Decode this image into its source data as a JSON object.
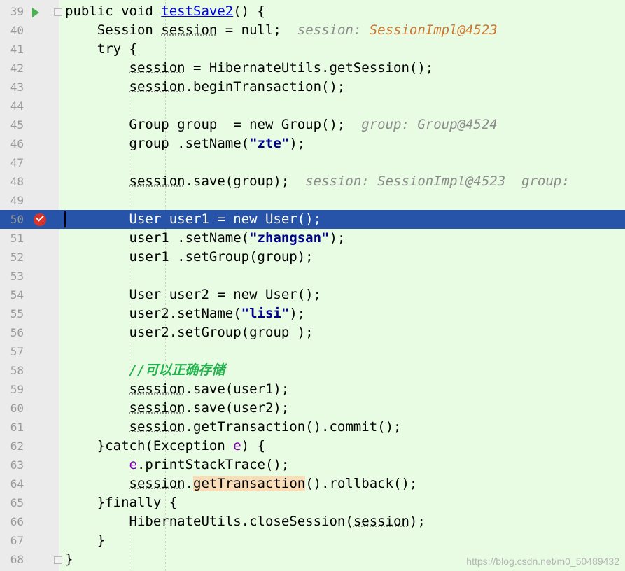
{
  "editor": {
    "lines": [
      {
        "num": "39",
        "segments": [
          {
            "t": "public void "
          },
          {
            "t": "testSave2",
            "c": "method-def"
          },
          {
            "t": "() {"
          }
        ]
      },
      {
        "num": "40",
        "segments": [
          {
            "t": "    Session "
          },
          {
            "t": "session",
            "c": "ul"
          },
          {
            "t": " = null;  "
          },
          {
            "t": "session: ",
            "c": "hint"
          },
          {
            "t": "SessionImpl@4523",
            "c": "hint-val"
          }
        ]
      },
      {
        "num": "41",
        "segments": [
          {
            "t": "    try {"
          }
        ]
      },
      {
        "num": "42",
        "segments": [
          {
            "t": "        "
          },
          {
            "t": "session",
            "c": "ul"
          },
          {
            "t": " = HibernateUtils.getSession();"
          }
        ]
      },
      {
        "num": "43",
        "segments": [
          {
            "t": "        "
          },
          {
            "t": "session",
            "c": "ul"
          },
          {
            "t": ".beginTransaction();"
          }
        ]
      },
      {
        "num": "44",
        "segments": [
          {
            "t": ""
          }
        ]
      },
      {
        "num": "45",
        "segments": [
          {
            "t": "        Group group  = new Group();  "
          },
          {
            "t": "group: Group@4524",
            "c": "hint"
          }
        ]
      },
      {
        "num": "46",
        "segments": [
          {
            "t": "        group .setName("
          },
          {
            "t": "\"zte\"",
            "c": "str"
          },
          {
            "t": ");"
          }
        ]
      },
      {
        "num": "47",
        "segments": [
          {
            "t": ""
          }
        ]
      },
      {
        "num": "48",
        "segments": [
          {
            "t": "        "
          },
          {
            "t": "session",
            "c": "ul"
          },
          {
            "t": ".save(group);  "
          },
          {
            "t": "session: SessionImpl@4523  group:",
            "c": "hint"
          }
        ]
      },
      {
        "num": "49",
        "segments": [
          {
            "t": ""
          }
        ]
      },
      {
        "num": "50",
        "current": true,
        "segments": [
          {
            "t": "        User user1 = new User();"
          }
        ]
      },
      {
        "num": "51",
        "segments": [
          {
            "t": "        user1 .setName("
          },
          {
            "t": "\"zhangsan\"",
            "c": "str"
          },
          {
            "t": ");"
          }
        ]
      },
      {
        "num": "52",
        "segments": [
          {
            "t": "        user1 .setGroup(group);"
          }
        ]
      },
      {
        "num": "53",
        "segments": [
          {
            "t": ""
          }
        ]
      },
      {
        "num": "54",
        "segments": [
          {
            "t": "        User user2 = new User();"
          }
        ]
      },
      {
        "num": "55",
        "segments": [
          {
            "t": "        user2.setName("
          },
          {
            "t": "\"lisi\"",
            "c": "str"
          },
          {
            "t": ");"
          }
        ]
      },
      {
        "num": "56",
        "segments": [
          {
            "t": "        user2.setGroup(group );"
          }
        ]
      },
      {
        "num": "57",
        "segments": [
          {
            "t": ""
          }
        ]
      },
      {
        "num": "58",
        "segments": [
          {
            "t": "        "
          },
          {
            "t": "//可以正确存储",
            "c": "cmt"
          }
        ]
      },
      {
        "num": "59",
        "segments": [
          {
            "t": "        "
          },
          {
            "t": "session",
            "c": "ul"
          },
          {
            "t": ".save(user1);"
          }
        ]
      },
      {
        "num": "60",
        "segments": [
          {
            "t": "        "
          },
          {
            "t": "session",
            "c": "ul"
          },
          {
            "t": ".save(user2);"
          }
        ]
      },
      {
        "num": "61",
        "segments": [
          {
            "t": "        "
          },
          {
            "t": "session",
            "c": "ul"
          },
          {
            "t": ".getTransaction().commit();"
          }
        ]
      },
      {
        "num": "62",
        "segments": [
          {
            "t": "    }catch(Exception "
          },
          {
            "t": "e",
            "c": "param"
          },
          {
            "t": ") {"
          }
        ]
      },
      {
        "num": "63",
        "segments": [
          {
            "t": "        "
          },
          {
            "t": "e",
            "c": "param"
          },
          {
            "t": ".printStackTrace();"
          }
        ]
      },
      {
        "num": "64",
        "segments": [
          {
            "t": "        "
          },
          {
            "t": "session",
            "c": "ul"
          },
          {
            "t": "."
          },
          {
            "t": "getTransaction",
            "c": "hl"
          },
          {
            "t": "().rollback();"
          }
        ]
      },
      {
        "num": "65",
        "segments": [
          {
            "t": "    }finally {"
          }
        ]
      },
      {
        "num": "66",
        "segments": [
          {
            "t": "        HibernateUtils.closeSession("
          },
          {
            "t": "session",
            "c": "ul"
          },
          {
            "t": ");"
          }
        ]
      },
      {
        "num": "67",
        "segments": [
          {
            "t": "    }"
          }
        ]
      },
      {
        "num": "68",
        "segments": [
          {
            "t": "}"
          }
        ]
      }
    ]
  },
  "watermark": "https://blog.csdn.net/m0_50489432",
  "colors": {
    "background": "#E8FCE3",
    "current_line": "#2753A8",
    "string": "#00008B",
    "comment": "#22B14C",
    "hint": "#8C8C8C",
    "hint_value": "#CC7832"
  },
  "icons": {
    "line39": "run-gutter-icon",
    "line50": "breakpoint-icon",
    "fold": "fold-marker-icon"
  }
}
